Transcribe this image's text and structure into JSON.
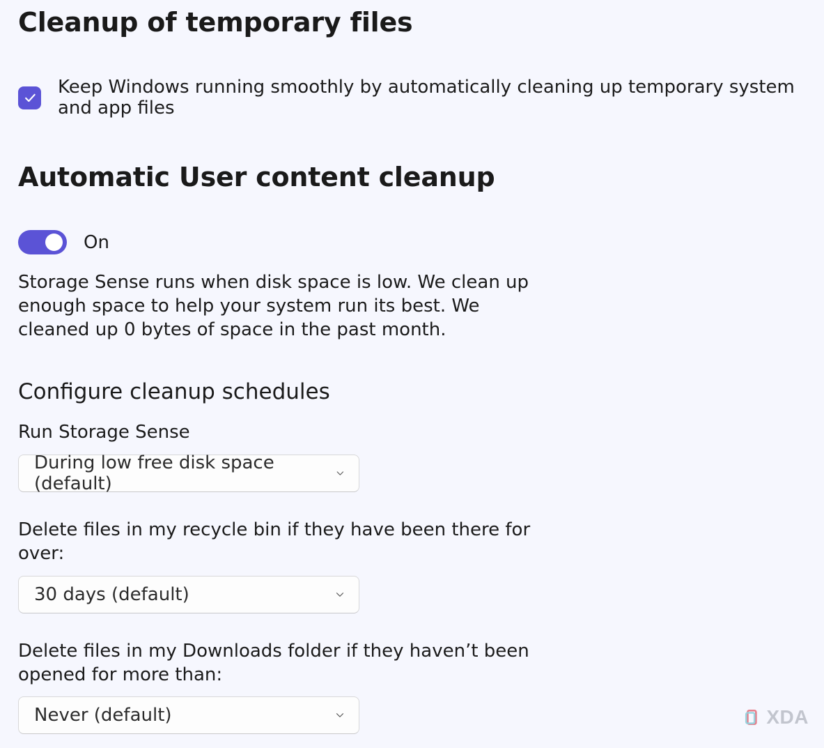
{
  "section1": {
    "title": "Cleanup of temporary files",
    "checkbox_label": "Keep Windows running smoothly by automatically cleaning up temporary system and app files"
  },
  "section2": {
    "title": "Automatic User content cleanup",
    "toggle_state_label": "On",
    "description": "Storage Sense runs when disk space is low. We clean up enough space to help your system run its best. We cleaned up 0 bytes of space in the past month."
  },
  "schedules": {
    "title": "Configure cleanup schedules",
    "run_sense_label": "Run Storage Sense",
    "run_sense_value": "During low free disk space (default)",
    "recycle_label": "Delete files in my recycle bin if they have been there for over:",
    "recycle_value": "30 days (default)",
    "downloads_label": "Delete files in my Downloads folder if they haven’t been opened for more than:",
    "downloads_value": "Never (default)"
  },
  "watermark": {
    "text": "XDA"
  }
}
